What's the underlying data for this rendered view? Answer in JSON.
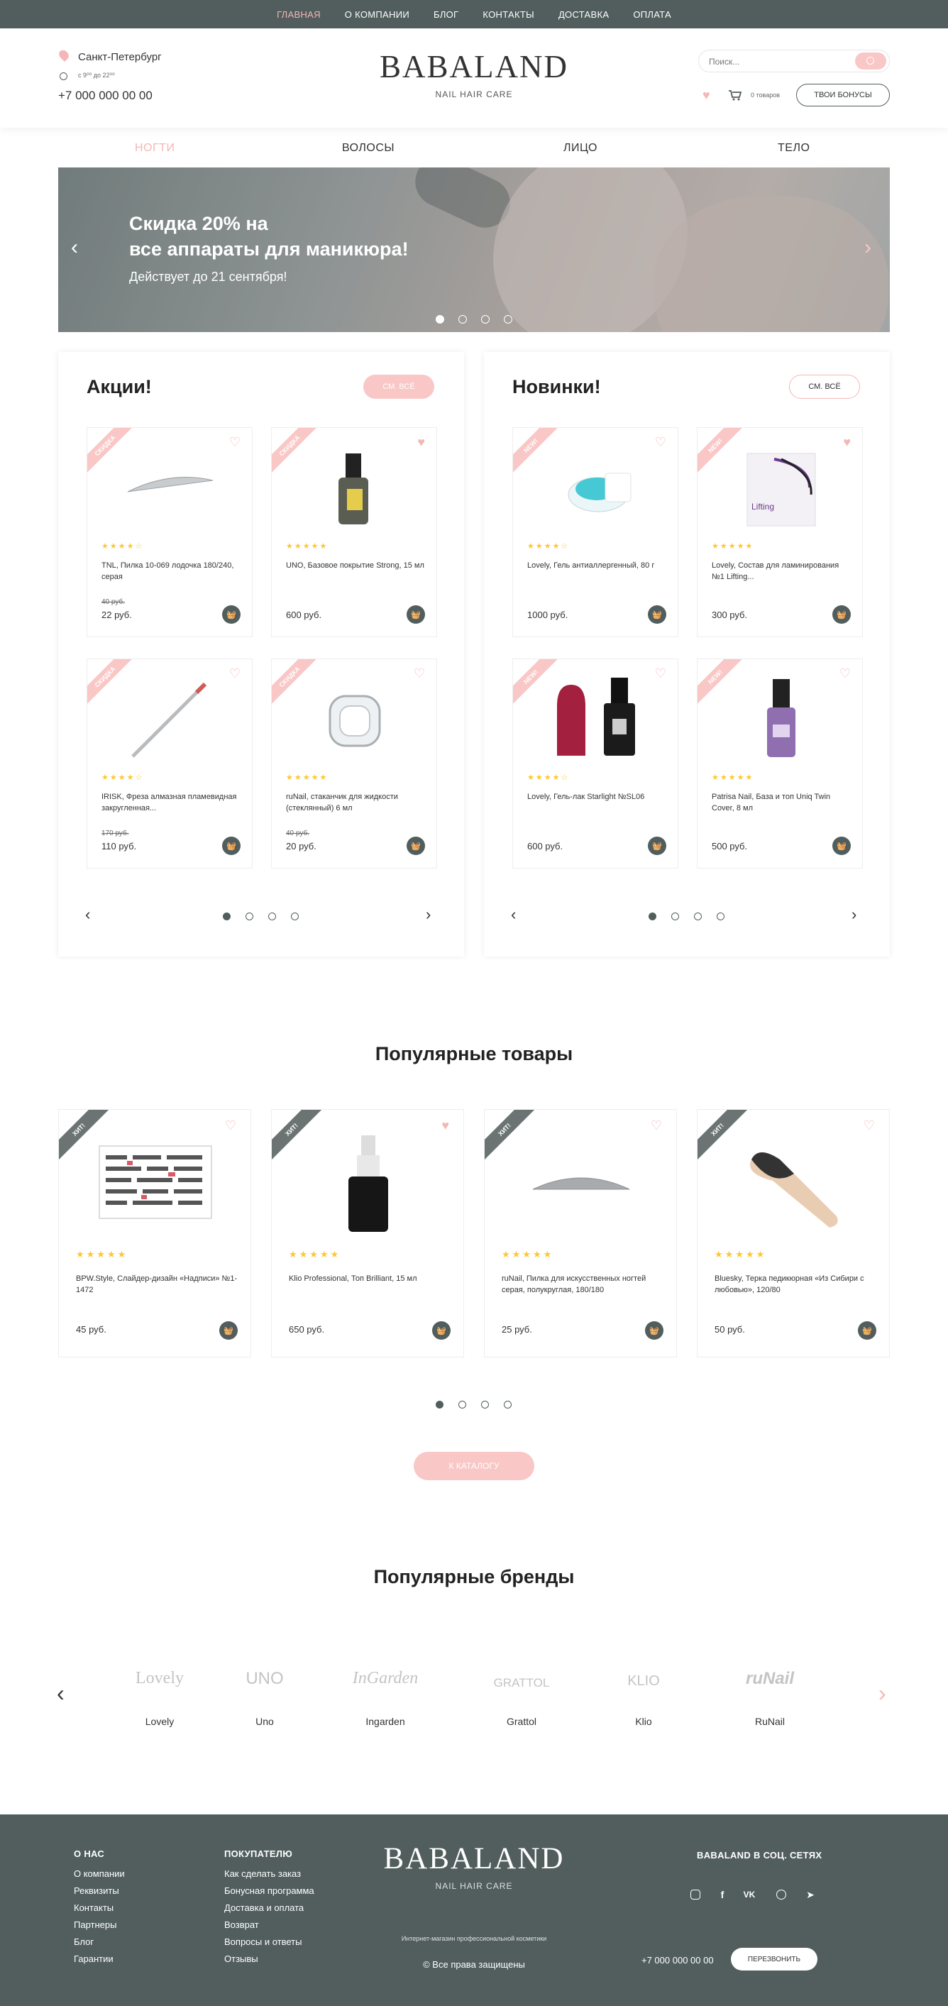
{
  "topnav": [
    "ГЛАВНАЯ",
    "О КОМПАНИИ",
    "БЛОГ",
    "КОНТАКТЫ",
    "ДОСТАВКА",
    "ОПЛАТА"
  ],
  "header": {
    "city": "Санкт-Петербург",
    "hours": "с 9⁰⁰ до 22⁰⁰",
    "phone": "+7 000 000 00 00",
    "logo": "BABALAND",
    "logo_sub": "NAIL HAIR CARE",
    "search_placeholder": "Поиск...",
    "cart_count": "0 товаров",
    "bonus_button": "ТВОИ БОНУСЫ"
  },
  "categories": [
    "НОГТИ",
    "ВОЛОСЫ",
    "ЛИЦО",
    "ТЕЛО"
  ],
  "banner": {
    "title1": "Скидка 20% на",
    "title2": "все аппараты для маникюра!",
    "subtitle": "Действует до 21 сентября!"
  },
  "sale": {
    "title": "Акции!",
    "button": "СМ. ВСЁ",
    "ribbon": "СКИДКА",
    "items": [
      {
        "name": "TNL, Пилка 10-069 лодочка 180/240, серая",
        "old": "40 руб.",
        "price": "22 руб.",
        "rating": 4
      },
      {
        "name": "UNO, Базовое покрытие Strong, 15 мл",
        "old": "",
        "price": "600 руб.",
        "rating": 5
      },
      {
        "name": "IRISK, Фреза алмазная пламевидная закругленная...",
        "old": "170 руб.",
        "price": "110 руб.",
        "rating": 4
      },
      {
        "name": "ruNail, стаканчик для жидкости (стеклянный) 6 мл",
        "old": "40 руб.",
        "price": "20 руб.",
        "rating": 5
      }
    ]
  },
  "new": {
    "title": "Новинки!",
    "button": "СМ. ВСЁ",
    "ribbon": "NEW!",
    "items": [
      {
        "name": "Lovely, Гель антиаллергенный, 80 г",
        "price": "1000 руб.",
        "rating": 4
      },
      {
        "name": "Lovely, Состав для ламинирования №1 Lifting...",
        "price": "300 руб.",
        "rating": 5
      },
      {
        "name": "Lovely, Гель-лак Starlight №SL06",
        "price": "600 руб.",
        "rating": 4
      },
      {
        "name": "Patrisa Nail, База и топ Uniq Twin Cover, 8 мл",
        "price": "500 руб.",
        "rating": 5
      }
    ],
    "lifting_label": "Lifting"
  },
  "popular": {
    "title": "Популярные товары",
    "ribbon": "ХИТ!",
    "items": [
      {
        "name": "BPW.Style, Слайдер-дизайн «Надписи» №1-1472",
        "price": "45 руб.",
        "rating": 5
      },
      {
        "name": "Klio Professional, Топ Brilliant, 15 мл",
        "price": "650 руб.",
        "rating": 5
      },
      {
        "name": "ruNail, Пилка для искусственных ногтей серая, полукруглая, 180/180",
        "price": "25 руб.",
        "rating": 5
      },
      {
        "name": "Bluesky, Терка педикюрная «Из Сибири с любовью», 120/80",
        "price": "50 руб.",
        "rating": 5
      }
    ],
    "catalog_button": "К КАТАЛОГУ"
  },
  "brands": {
    "title": "Популярные бренды",
    "items": [
      {
        "logo": "Lovely",
        "name": "Lovely"
      },
      {
        "logo": "UNO",
        "name": "Uno"
      },
      {
        "logo": "InGarden",
        "name": "Ingarden"
      },
      {
        "logo": "GRATTOL",
        "name": "Grattol"
      },
      {
        "logo": "KLIO",
        "name": "Klio"
      },
      {
        "logo": "ruNail",
        "name": "RuNail"
      }
    ]
  },
  "footer": {
    "col1_title": "О НАС",
    "col1": [
      "О компании",
      "Реквизиты",
      "Контакты",
      "Партнеры",
      "Блог",
      "Гарантии"
    ],
    "col2_title": "ПОКУПАТЕЛЮ",
    "col2": [
      "Как сделать заказ",
      "Бонусная программа",
      "Доставка и оплата",
      "Возврат",
      "Вопросы и ответы",
      "Отзывы"
    ],
    "logo": "BABALAND",
    "logo_sub": "NAIL HAIR CARE",
    "tagline": "Интернет-магазин профессиональной косметики",
    "copyright": "©  Все права защищены",
    "social_title": "BABALAND В СОЦ. СЕТЯХ",
    "phone": "+7 000 000 00 00",
    "callback": "ПЕРЕЗВОНИТЬ"
  },
  "colors": {
    "accent": "#f4b7b6",
    "dark": "#515e5d",
    "star": "#ffc72c"
  }
}
